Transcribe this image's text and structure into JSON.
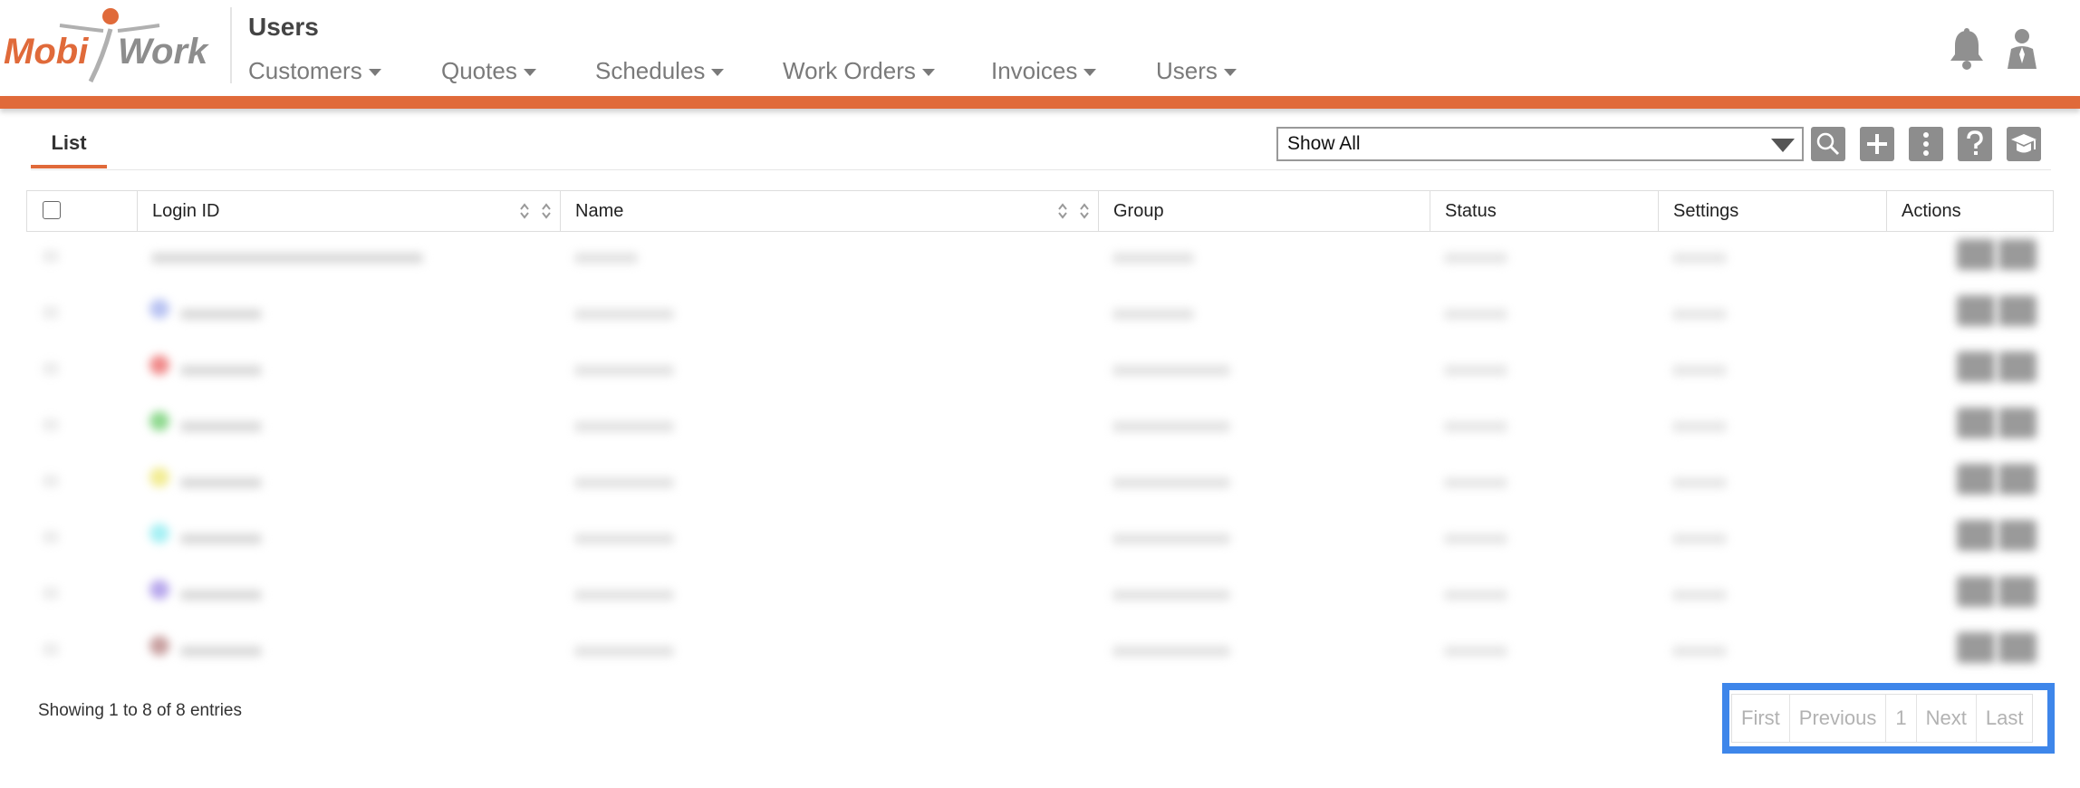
{
  "app": {
    "logo_text_left": "Mobi",
    "logo_text_right": "Work",
    "page_title": "Users",
    "brand_color": "#e06a3a"
  },
  "nav": [
    {
      "label": "Customers"
    },
    {
      "label": "Quotes"
    },
    {
      "label": "Schedules"
    },
    {
      "label": "Work Orders"
    },
    {
      "label": "Invoices"
    },
    {
      "label": "Users"
    }
  ],
  "header_icons": [
    "bell-icon",
    "user-icon"
  ],
  "toolbar": {
    "tab_label": "List",
    "filter_value": "Show All",
    "buttons": [
      "search-icon",
      "plus-icon",
      "more-vertical-icon",
      "help-icon",
      "graduation-cap-icon"
    ]
  },
  "table": {
    "columns": [
      "Login ID",
      "Name",
      "Group",
      "Status",
      "Settings",
      "Actions"
    ],
    "row_count": 8,
    "row_accent_colors": [
      "#ffffff",
      "#b9c3f2",
      "#f08a8a",
      "#8fd98f",
      "#f2ec94",
      "#a6f0f4",
      "#b8a8ec",
      "#c8a0a0"
    ]
  },
  "footer": {
    "showing_text": "Showing 1 to 8 of 8 entries",
    "pagination": [
      "First",
      "Previous",
      "1",
      "Next",
      "Last"
    ]
  }
}
